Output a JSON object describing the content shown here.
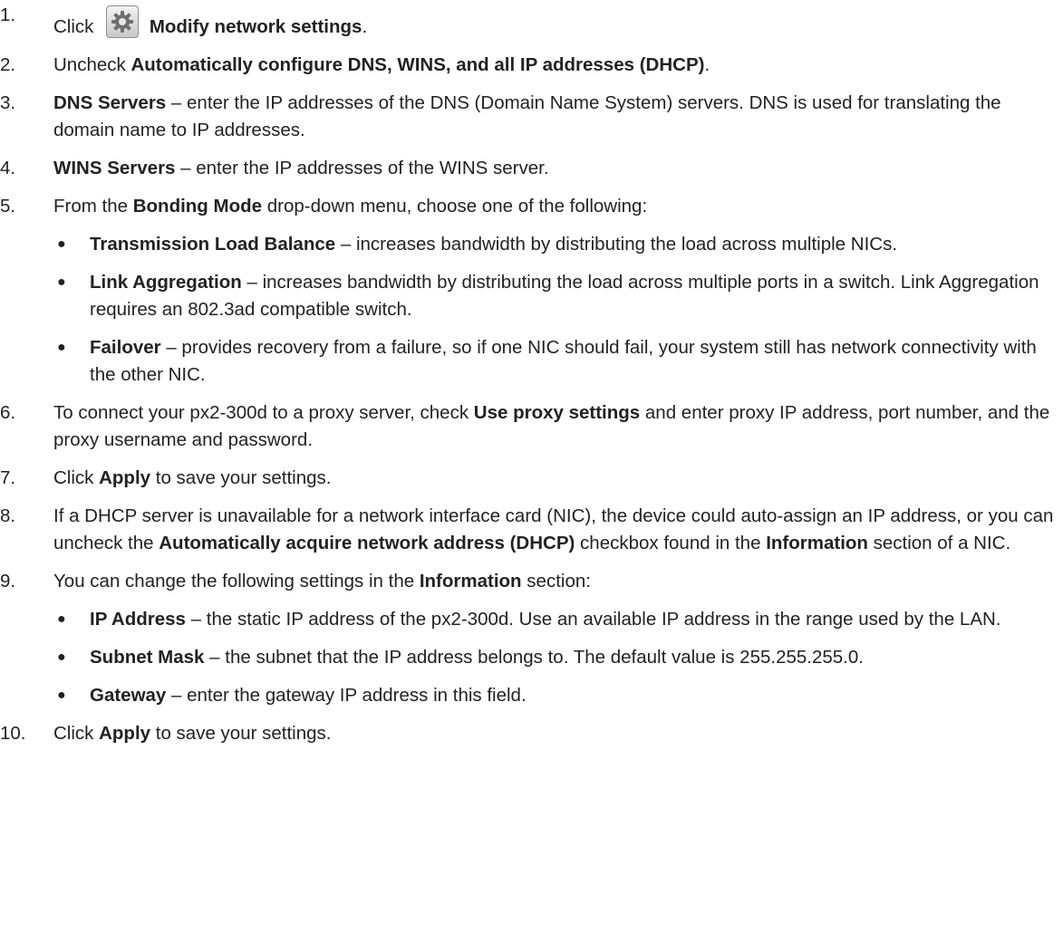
{
  "steps": [
    {
      "num": "1.",
      "pre": "Click ",
      "icon": "gear-icon",
      "bold1": "Modify network settings",
      "post1": "."
    },
    {
      "num": "2.",
      "pre": "Uncheck ",
      "bold1": "Automatically configure DNS, WINS, and all IP addresses (DHCP)",
      "post1": "."
    },
    {
      "num": "3.",
      "bold1": "DNS Servers",
      "post1": " – enter the IP addresses of the DNS (Domain Name System) servers. DNS is used for translating the domain name to IP addresses."
    },
    {
      "num": "4.",
      "bold1": "WINS Servers",
      "post1": " – enter the IP addresses of the WINS server."
    },
    {
      "num": "5.",
      "pre": "From the ",
      "bold1": "Bonding Mode",
      "post1": " drop-down menu, choose one of the following:",
      "bullets": [
        {
          "bold": "Transmission Load Balance",
          "text": " – increases bandwidth by distributing the load across multiple NICs."
        },
        {
          "bold": "Link Aggregation",
          "text": " – increases bandwidth by distributing the load across multiple ports in a switch. Link Aggregation requires an 802.3ad compatible switch."
        },
        {
          "bold": "Failover",
          "text": " – provides recovery from a failure, so if one NIC should fail, your system still has network connectivity with the other NIC."
        }
      ]
    },
    {
      "num": "6.",
      "pre": "To connect your px2-300d to a proxy server, check ",
      "bold1": "Use proxy settings",
      "post1": " and enter proxy IP address, port number, and the proxy username and password."
    },
    {
      "num": "7.",
      "pre": "Click ",
      "bold1": "Apply",
      "post1": " to save your settings."
    },
    {
      "num": "8.",
      "pre": "If a DHCP server is unavailable for a network interface card (NIC), the device could auto-assign an IP address, or you can uncheck the ",
      "bold1": "Automatically acquire network address (DHCP)",
      "post1": " checkbox found in the ",
      "bold2": "Information",
      "post2": " section of a NIC."
    },
    {
      "num": "9.",
      "pre": "You can change the following settings in the ",
      "bold1": "Information",
      "post1": " section:",
      "bullets": [
        {
          "bold": "IP Address",
          "text": " – the static IP address of the px2-300d. Use an available IP address in the range used by the LAN."
        },
        {
          "bold": "Subnet Mask",
          "text": " – the subnet that the IP address belongs to. The default value is 255.255.255.0."
        },
        {
          "bold": "Gateway",
          "text": " – enter the gateway IP address in this field."
        }
      ]
    },
    {
      "num": "10.",
      "pre": "Click ",
      "bold1": "Apply",
      "post1": " to save your settings."
    }
  ],
  "bullet_glyph": "●"
}
